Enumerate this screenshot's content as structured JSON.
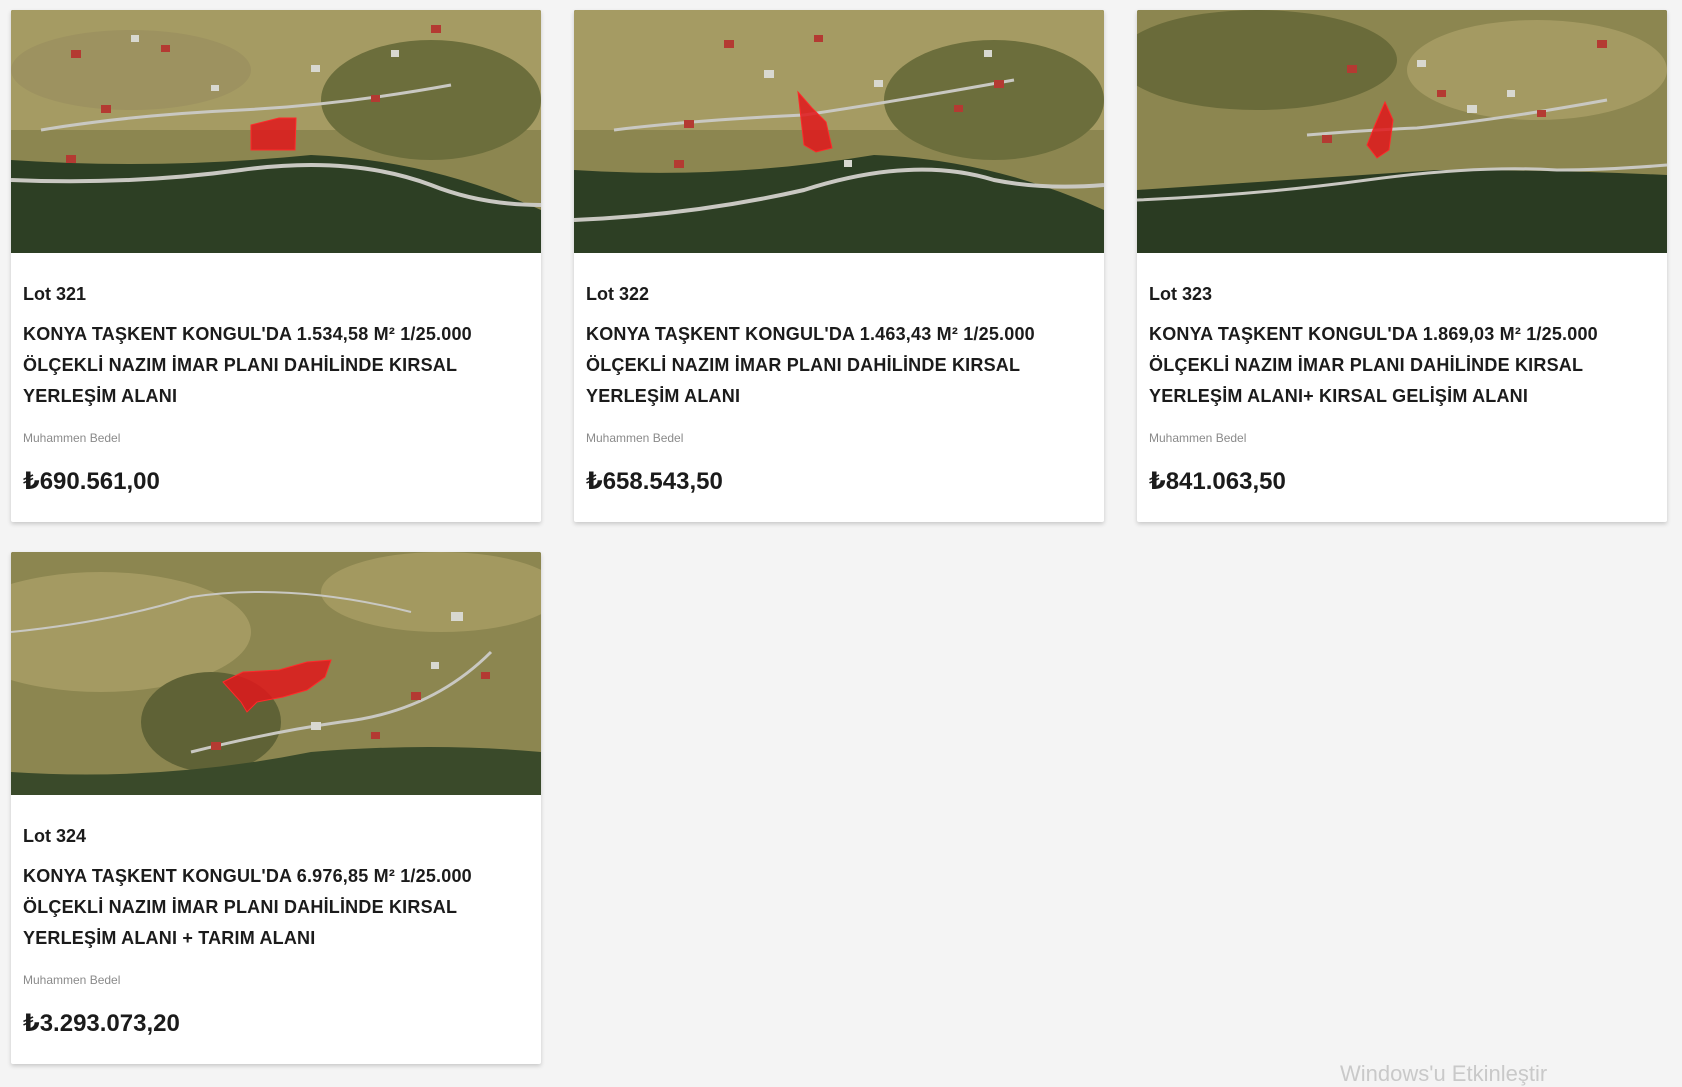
{
  "listing": {
    "cards": [
      {
        "lot": "Lot 321",
        "title": "KONYA TAŞKENT KONGUL'DA 1.534,58 M² 1/25.000 ÖLÇEKLİ NAZIM İMAR PLANI DAHİLİNDE KIRSAL YERLEŞİM ALANI",
        "price_label": "Muhammen Bedel",
        "price": "₺690.561,00",
        "image_icon": "satellite-map-image"
      },
      {
        "lot": "Lot 322",
        "title": "KONYA TAŞKENT KONGUL'DA 1.463,43 M² 1/25.000 ÖLÇEKLİ NAZIM İMAR PLANI DAHİLİNDE KIRSAL YERLEŞİM ALANI",
        "price_label": "Muhammen Bedel",
        "price": "₺658.543,50",
        "image_icon": "satellite-map-image"
      },
      {
        "lot": "Lot 323",
        "title": "KONYA TAŞKENT KONGUL'DA 1.869,03 M² 1/25.000 ÖLÇEKLİ NAZIM İMAR PLANI DAHİLİNDE KIRSAL YERLEŞİM ALANI+ KIRSAL GELİŞİM ALANI",
        "price_label": "Muhammen Bedel",
        "price": "₺841.063,50",
        "image_icon": "satellite-map-image"
      },
      {
        "lot": "Lot 324",
        "title": "KONYA TAŞKENT KONGUL'DA 6.976,85 M² 1/25.000 ÖLÇEKLİ NAZIM İMAR PLANI DAHİLİNDE KIRSAL YERLEŞİM ALANI + TARIM ALANI",
        "price_label": "Muhammen Bedel",
        "price": "₺3.293.073,20",
        "image_icon": "satellite-map-image"
      }
    ]
  },
  "watermark": "Windows'u Etkinleştir",
  "colors": {
    "parcel_highlight": "#e0181b",
    "page_background": "#f4f4f4",
    "card_background": "#ffffff",
    "label_gray": "#8a8a8a",
    "text_dark": "#1b1b1b"
  }
}
